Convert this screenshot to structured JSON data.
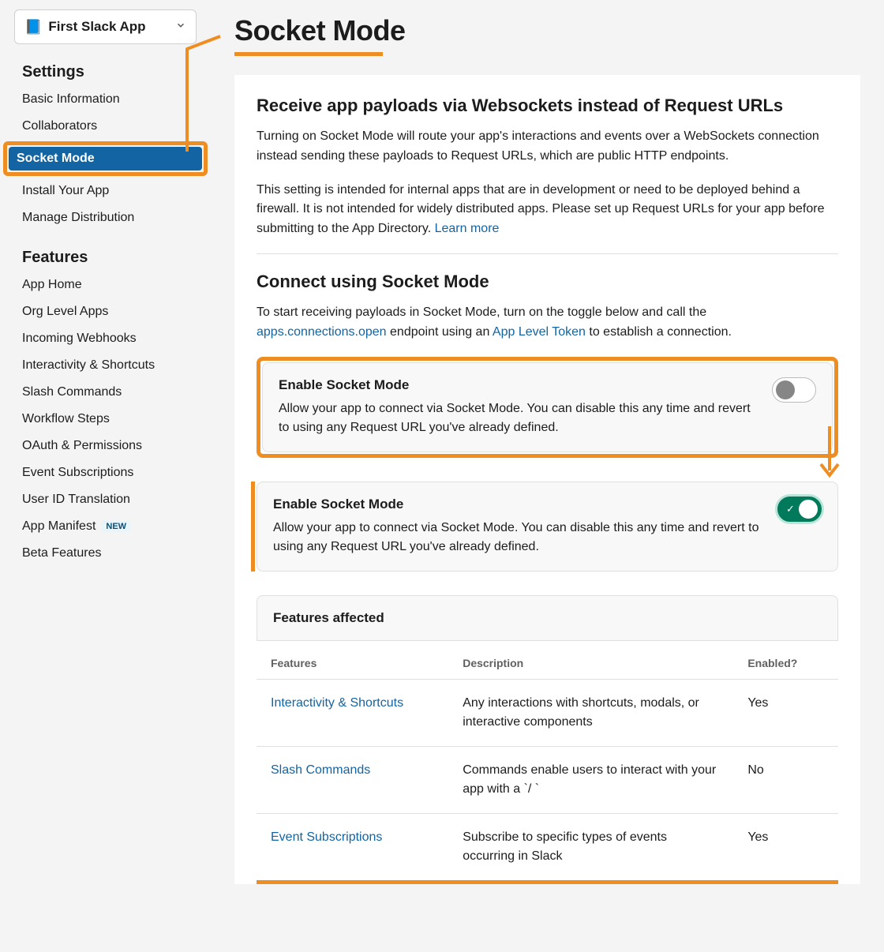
{
  "sidebar": {
    "app_name": "First Slack App",
    "app_icon": "📘",
    "sections": [
      {
        "title": "Settings",
        "items": [
          {
            "label": "Basic Information",
            "active": false
          },
          {
            "label": "Collaborators",
            "active": false
          },
          {
            "label": "Socket Mode",
            "active": true
          },
          {
            "label": "Install Your App",
            "active": false
          },
          {
            "label": "Manage Distribution",
            "active": false
          }
        ]
      },
      {
        "title": "Features",
        "items": [
          {
            "label": "App Home"
          },
          {
            "label": "Org Level Apps"
          },
          {
            "label": "Incoming Webhooks"
          },
          {
            "label": "Interactivity & Shortcuts"
          },
          {
            "label": "Slash Commands"
          },
          {
            "label": "Workflow Steps"
          },
          {
            "label": "OAuth & Permissions"
          },
          {
            "label": "Event Subscriptions"
          },
          {
            "label": "User ID Translation"
          },
          {
            "label": "App Manifest",
            "badge": "NEW"
          },
          {
            "label": "Beta Features"
          }
        ]
      }
    ]
  },
  "page": {
    "title": "Socket Mode",
    "receive": {
      "heading": "Receive app payloads via Websockets instead of Request URLs",
      "p1": "Turning on Socket Mode will route your app's interactions and events over a WebSockets connection instead sending these payloads to Request URLs, which are public HTTP endpoints.",
      "p2a": "This setting is intended for internal apps that are in development or need to be deployed behind a firewall. It is not intended for widely distributed apps. Please set up Request URLs for your app before submitting to the App Directory. ",
      "learn_more": "Learn more"
    },
    "connect": {
      "heading": "Connect using Socket Mode",
      "p_a": "To start receiving payloads in Socket Mode, turn on the toggle below and call the ",
      "api_link": "apps.connections.open",
      "p_b": " endpoint using an ",
      "token_link": "App Level Token",
      "p_c": " to establish a connection."
    },
    "toggle_off": {
      "title": "Enable Socket Mode",
      "desc": "Allow your app to connect via Socket Mode. You can disable this any time and revert to using any Request URL you've already defined."
    },
    "toggle_on": {
      "title": "Enable Socket Mode",
      "desc": "Allow your app to connect via Socket Mode. You can disable this any time and revert to using any Request URL you've already defined."
    },
    "features_affected": {
      "title": "Features affected",
      "cols": {
        "feature": "Features",
        "desc": "Description",
        "enabled": "Enabled?"
      },
      "rows": [
        {
          "feature": "Interactivity & Shortcuts",
          "desc": "Any interactions with shortcuts, modals, or interactive components",
          "enabled": "Yes"
        },
        {
          "feature": "Slash Commands",
          "desc": "Commands enable users to interact with your app with a `/ `",
          "enabled": "No"
        },
        {
          "feature": "Event Subscriptions",
          "desc": "Subscribe to specific types of events occurring in Slack",
          "enabled": "Yes"
        }
      ]
    }
  }
}
